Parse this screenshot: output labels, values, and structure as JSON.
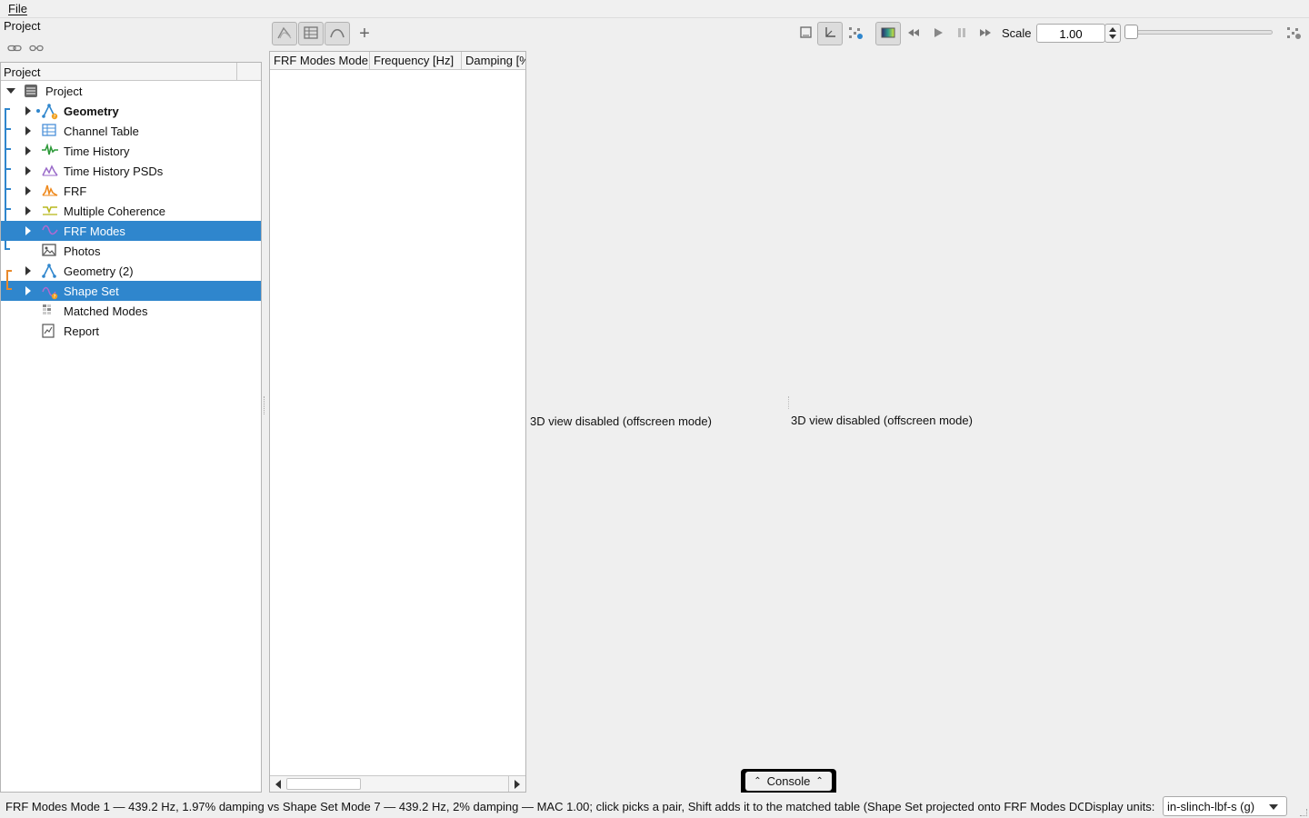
{
  "menu": {
    "file_label": "File"
  },
  "sidebar": {
    "title": "Project",
    "link_icons": [
      "link-icon",
      "unlink-icon"
    ],
    "tree_header": "Project",
    "items": [
      {
        "label": "Project",
        "icon": "project-icon",
        "bold": false,
        "selected": false,
        "expanded": true
      },
      {
        "label": "Geometry",
        "icon": "geometry-icon",
        "bold": true,
        "selected": false
      },
      {
        "label": "Channel Table",
        "icon": "table-icon",
        "bold": false,
        "selected": false
      },
      {
        "label": "Time History",
        "icon": "time-history-icon",
        "bold": false,
        "selected": false
      },
      {
        "label": "Time History PSDs",
        "icon": "psd-icon",
        "bold": false,
        "selected": false
      },
      {
        "label": "FRF",
        "icon": "frf-icon",
        "bold": false,
        "selected": false
      },
      {
        "label": "Multiple Coherence",
        "icon": "coherence-icon",
        "bold": false,
        "selected": false
      },
      {
        "label": "FRF Modes",
        "icon": "frf-modes-icon",
        "bold": false,
        "selected": true
      },
      {
        "label": "Photos",
        "icon": "photo-icon",
        "bold": false,
        "selected": false
      },
      {
        "label": "Geometry (2)",
        "icon": "geometry-icon",
        "bold": false,
        "selected": false
      },
      {
        "label": "Shape Set",
        "icon": "shape-set-icon",
        "bold": false,
        "selected": true
      },
      {
        "label": "Matched Modes",
        "icon": "matched-modes-icon",
        "bold": false,
        "selected": false
      },
      {
        "label": "Report",
        "icon": "report-icon",
        "bold": false,
        "selected": false
      }
    ]
  },
  "toolbar": {
    "buttons": [
      "mode-shape-icon",
      "table-icon",
      "arc-icon"
    ],
    "add_label": "+"
  },
  "modes_table": {
    "columns": [
      "FRF Modes Mode",
      "Frequency [Hz]",
      "Damping [%"
    ]
  },
  "viewports": {
    "left_message": "3D view disabled (offscreen mode)",
    "right_message": "3D view disabled (offscreen mode)"
  },
  "animation": {
    "icons": [
      "single-view-icon",
      "axes-icon",
      "scatter-icon",
      "colormap-icon",
      "rewind-icon",
      "play-icon",
      "pause-icon",
      "fast-forward-icon"
    ],
    "scale_label": "Scale",
    "scale_value": "1.00",
    "slider_fraction": 0.0,
    "extra_icon": "layout-icon"
  },
  "console": {
    "label": "Console"
  },
  "status": {
    "message": "FRF Modes Mode 1 — 439.2 Hz, 1.97% damping vs Shape Set Mode 7 — 439.2 Hz, 2% damping — MAC 1.00; click picks a pair, Shift adds it to the matched table (Shape Set projected onto FRF Modes DOFs)",
    "units_label": "Display units:",
    "units_value": "in-slinch-lbf-s (g)"
  },
  "colors": {
    "selection": "#2f86cd",
    "bracket_blue": "#2f86cd",
    "bracket_orange": "#e8892b"
  }
}
